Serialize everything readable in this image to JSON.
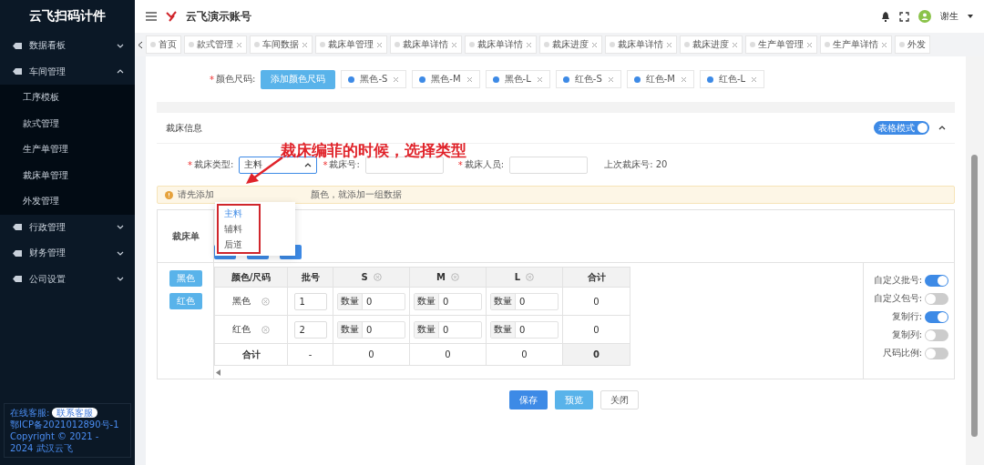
{
  "sidebar": {
    "title": "云飞扫码计件",
    "items": [
      {
        "label": "数据看板",
        "expanded": false
      },
      {
        "label": "车间管理",
        "expanded": true,
        "children": [
          {
            "label": "工序模板"
          },
          {
            "label": "款式管理"
          },
          {
            "label": "生产单管理"
          },
          {
            "label": "裁床单管理"
          },
          {
            "label": "外发管理"
          }
        ]
      },
      {
        "label": "行政管理",
        "expanded": false
      },
      {
        "label": "财务管理",
        "expanded": false
      },
      {
        "label": "公司设置",
        "expanded": false
      }
    ],
    "footer": {
      "service_label": "在线客服:",
      "service_button": "联系客服",
      "icp": "鄂ICP备2021012890号-1",
      "copyright": "Copyright © 2021 - 2024 武汉云飞"
    }
  },
  "header": {
    "account": "云飞演示账号",
    "user": "谢生"
  },
  "tabs": [
    {
      "label": "首页",
      "closable": false
    },
    {
      "label": "款式管理",
      "closable": true
    },
    {
      "label": "车间数据",
      "closable": true
    },
    {
      "label": "裁床单管理",
      "closable": true
    },
    {
      "label": "裁床单详情",
      "closable": true
    },
    {
      "label": "裁床单详情",
      "closable": true
    },
    {
      "label": "裁床进度",
      "closable": true
    },
    {
      "label": "裁床单详情",
      "closable": true
    },
    {
      "label": "裁床进度",
      "closable": true
    },
    {
      "label": "生产单管理",
      "closable": true
    },
    {
      "label": "生产单详情",
      "closable": true
    },
    {
      "label": "外发",
      "closable": false
    }
  ],
  "color_sizes": {
    "mark": "*",
    "label": "颜色尺码:",
    "add_button": "添加颜色尺码",
    "tags": [
      "黑色-S",
      "黑色-M",
      "黑色-L",
      "红色-S",
      "红色-M",
      "红色-L"
    ]
  },
  "section": {
    "title": "裁床信息",
    "mode_switch": {
      "label": "表格模式",
      "on": true
    }
  },
  "form": {
    "type_mark": "*",
    "type_label": "裁床类型:",
    "type_value": "主料",
    "number_mark": "*",
    "number_label": "裁床号:",
    "staff_mark": "*",
    "staff_label": "裁床人员:",
    "last_number": "上次裁床号: 20"
  },
  "dropdown": {
    "options": [
      {
        "label": "主料",
        "selected": true
      },
      {
        "label": "辅料",
        "selected": false
      },
      {
        "label": "后道",
        "selected": false
      }
    ]
  },
  "annotation": "裁床编菲的时候，选择类型",
  "alert": {
    "start": "请先添加",
    "end": "颜色，就添加一组数据"
  },
  "cut_sheet_label": "裁床单",
  "color_buttons": [
    "黑色",
    "红色"
  ],
  "table": {
    "columns": [
      {
        "label": "颜色/尺码",
        "removable": false
      },
      {
        "label": "批号",
        "removable": false
      },
      {
        "label": "S",
        "removable": true
      },
      {
        "label": "M",
        "removable": true
      },
      {
        "label": "L",
        "removable": true
      },
      {
        "label": "合计",
        "removable": false
      }
    ],
    "rows": [
      {
        "cells": [
          {
            "kind": "name",
            "text": "黑色"
          },
          {
            "kind": "input",
            "text": "1"
          },
          {
            "kind": "quantity",
            "addon": "数量",
            "text": "0"
          },
          {
            "kind": "quantity",
            "addon": "数量",
            "text": "0"
          },
          {
            "kind": "quantity",
            "addon": "数量",
            "text": "0"
          },
          {
            "kind": "text",
            "text": "0"
          }
        ]
      },
      {
        "cells": [
          {
            "kind": "name",
            "text": "红色"
          },
          {
            "kind": "input",
            "text": "2"
          },
          {
            "kind": "quantity",
            "addon": "数量",
            "text": "0"
          },
          {
            "kind": "quantity",
            "addon": "数量",
            "text": "0"
          },
          {
            "kind": "quantity",
            "addon": "数量",
            "text": "0"
          },
          {
            "kind": "text",
            "text": "0"
          }
        ]
      },
      {
        "cells": [
          {
            "kind": "bold",
            "text": "合计"
          },
          {
            "kind": "text",
            "text": "-"
          },
          {
            "kind": "text",
            "text": "0"
          },
          {
            "kind": "text",
            "text": "0"
          },
          {
            "kind": "text",
            "text": "0"
          },
          {
            "kind": "grand",
            "text": "0"
          }
        ]
      }
    ]
  },
  "options": [
    {
      "label": "自定义批号:",
      "on": true
    },
    {
      "label": "自定义包号:",
      "on": false
    },
    {
      "label": "复制行:",
      "on": true
    },
    {
      "label": "复制列:",
      "on": false
    },
    {
      "label": "尺码比例:",
      "on": false
    }
  ],
  "buttons": [
    {
      "label": "保存",
      "kind": "primary"
    },
    {
      "label": "预览",
      "kind": "light"
    },
    {
      "label": "关闭",
      "kind": "plain"
    }
  ]
}
